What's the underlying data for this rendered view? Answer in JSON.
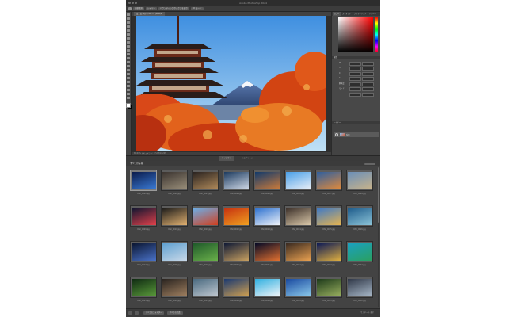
{
  "window": {
    "title": "Adobe Photoshop 2024",
    "document_tab": "富士山.jpg @ 66.7% (RGB/8)",
    "status": "66.67%  ドキュメント: 17.2M/17.2M"
  },
  "options_bar": {
    "tool_icon": "move-tool-icon",
    "items": [
      "自動選択",
      "レイヤー",
      "バウンディングボックスを表示",
      "3D モード"
    ]
  },
  "toolbar": {
    "tools": [
      "move",
      "marquee",
      "lasso",
      "quick-select",
      "crop",
      "frame",
      "eyedropper",
      "healing",
      "brush",
      "stamp",
      "history-brush",
      "eraser",
      "gradient",
      "blur",
      "dodge",
      "pen",
      "type",
      "path-select",
      "rectangle",
      "hand",
      "zoom",
      "more"
    ]
  },
  "right_panel": {
    "tabs": [
      "カラー",
      "スウォッチ",
      "グラデーション",
      "パターン"
    ],
    "properties_title": "属性",
    "properties_rows": [
      {
        "label": "W",
        "a": "",
        "b": ""
      },
      {
        "label": "H",
        "a": "",
        "b": ""
      },
      {
        "label": "X",
        "a": "",
        "b": ""
      },
      {
        "label": "Y",
        "a": "",
        "b": ""
      },
      {
        "label": "解像度",
        "a": "",
        "b": ""
      },
      {
        "label": "モード",
        "a": "",
        "b": ""
      },
      {
        "label": "",
        "a": "",
        "b": ""
      }
    ],
    "layers_title": "レイヤー",
    "layer_name": "背景",
    "colors": {
      "picker_hue": "#ff0000"
    }
  },
  "split_tabs": [
    "ライブラリ",
    "ミニブリッジ"
  ],
  "browser": {
    "title": "すべての写真",
    "footer_buttons": [
      "すべてのフォルダー",
      "すべての写真"
    ],
    "footer_right": "サムネール  表示"
  },
  "thumbnails": [
    {
      "caption": "DSC_0001.jpg",
      "c1": "#0a1a4a",
      "c2": "#3a7bd5",
      "selected": true
    },
    {
      "caption": "DSC_0002.jpg",
      "c1": "#3b3430",
      "c2": "#9a8f7a",
      "selected": false
    },
    {
      "caption": "DSC_0003.jpg",
      "c1": "#2a2320",
      "c2": "#b08a5a",
      "selected": false
    },
    {
      "caption": "DSC_0004.jpg",
      "c1": "#1d3b5f",
      "c2": "#cfd8e6",
      "selected": false
    },
    {
      "caption": "DSC_0005.jpg",
      "c1": "#123a6b",
      "c2": "#cc7b3a",
      "selected": false
    },
    {
      "caption": "DSC_0006.jpg",
      "c1": "#4aa0e8",
      "c2": "#e8eef6",
      "selected": false
    },
    {
      "caption": "DSC_0007.jpg",
      "c1": "#2f5f9f",
      "c2": "#e28a3a",
      "selected": false
    },
    {
      "caption": "DSC_0008.jpg",
      "c1": "#6b8fb8",
      "c2": "#c9b38a",
      "selected": false
    },
    {
      "caption": "DSC_0009.jpg",
      "c1": "#0b1530",
      "c2": "#e0404a",
      "selected": false
    },
    {
      "caption": "DSC_0010.jpg",
      "c1": "#1a1a1a",
      "c2": "#e0b070",
      "selected": false
    },
    {
      "caption": "DSC_0011.jpg",
      "c1": "#6ab0ea",
      "c2": "#d04020",
      "selected": false
    },
    {
      "caption": "DSC_0012.jpg",
      "c1": "#c63010",
      "c2": "#f0a020",
      "selected": false
    },
    {
      "caption": "DSC_0013.jpg",
      "c1": "#2a6fcf",
      "c2": "#eef2f8",
      "selected": false
    },
    {
      "caption": "DSC_0014.jpg",
      "c1": "#3a2e28",
      "c2": "#d9c7a8",
      "selected": false
    },
    {
      "caption": "DSC_0015.jpg",
      "c1": "#3b78c8",
      "c2": "#e6b450",
      "selected": false
    },
    {
      "caption": "DSC_0016.jpg",
      "c1": "#1c5a8a",
      "c2": "#8cc4d8",
      "selected": false
    },
    {
      "caption": "DSC_0017.jpg",
      "c1": "#0a1530",
      "c2": "#4a72c8",
      "selected": false
    },
    {
      "caption": "DSC_0018.jpg",
      "c1": "#5fa0d0",
      "c2": "#c8d8e8",
      "selected": false
    },
    {
      "caption": "DSC_0019.jpg",
      "c1": "#1f5a2a",
      "c2": "#6ab04a",
      "selected": false
    },
    {
      "caption": "DSC_0020.jpg",
      "c1": "#101a35",
      "c2": "#c8a060",
      "selected": false
    },
    {
      "caption": "DSC_0021.jpg",
      "c1": "#050a25",
      "c2": "#e07030",
      "selected": false
    },
    {
      "caption": "DSC_0022.jpg",
      "c1": "#3a2a20",
      "c2": "#e8a050",
      "selected": false
    },
    {
      "caption": "DSC_0023.jpg",
      "c1": "#0d1a55",
      "c2": "#e0b040",
      "selected": false
    },
    {
      "caption": "DSC_0024.jpg",
      "c1": "#1aa0c0",
      "c2": "#2aa060",
      "selected": false
    },
    {
      "caption": "DSC_0025.jpg",
      "c1": "#0f2a12",
      "c2": "#5a9a3a",
      "selected": false
    },
    {
      "caption": "DSC_0026.jpg",
      "c1": "#2a2420",
      "c2": "#a08060",
      "selected": false
    },
    {
      "caption": "DSC_0027.jpg",
      "c1": "#4a6a80",
      "c2": "#c0c8d0",
      "selected": false
    },
    {
      "caption": "DSC_0028.jpg",
      "c1": "#1c3a70",
      "c2": "#d0a050",
      "selected": false
    },
    {
      "caption": "DSC_0029.jpg",
      "c1": "#30b0e0",
      "c2": "#f0f4f8",
      "selected": false
    },
    {
      "caption": "DSC_0030.jpg",
      "c1": "#1a4aa0",
      "c2": "#8ac8ea",
      "selected": false
    },
    {
      "caption": "DSC_0031.jpg",
      "c1": "#1d3a1a",
      "c2": "#9ab060",
      "selected": false
    },
    {
      "caption": "DSC_0032.jpg",
      "c1": "#303848",
      "c2": "#a8b8c8",
      "selected": false
    }
  ]
}
